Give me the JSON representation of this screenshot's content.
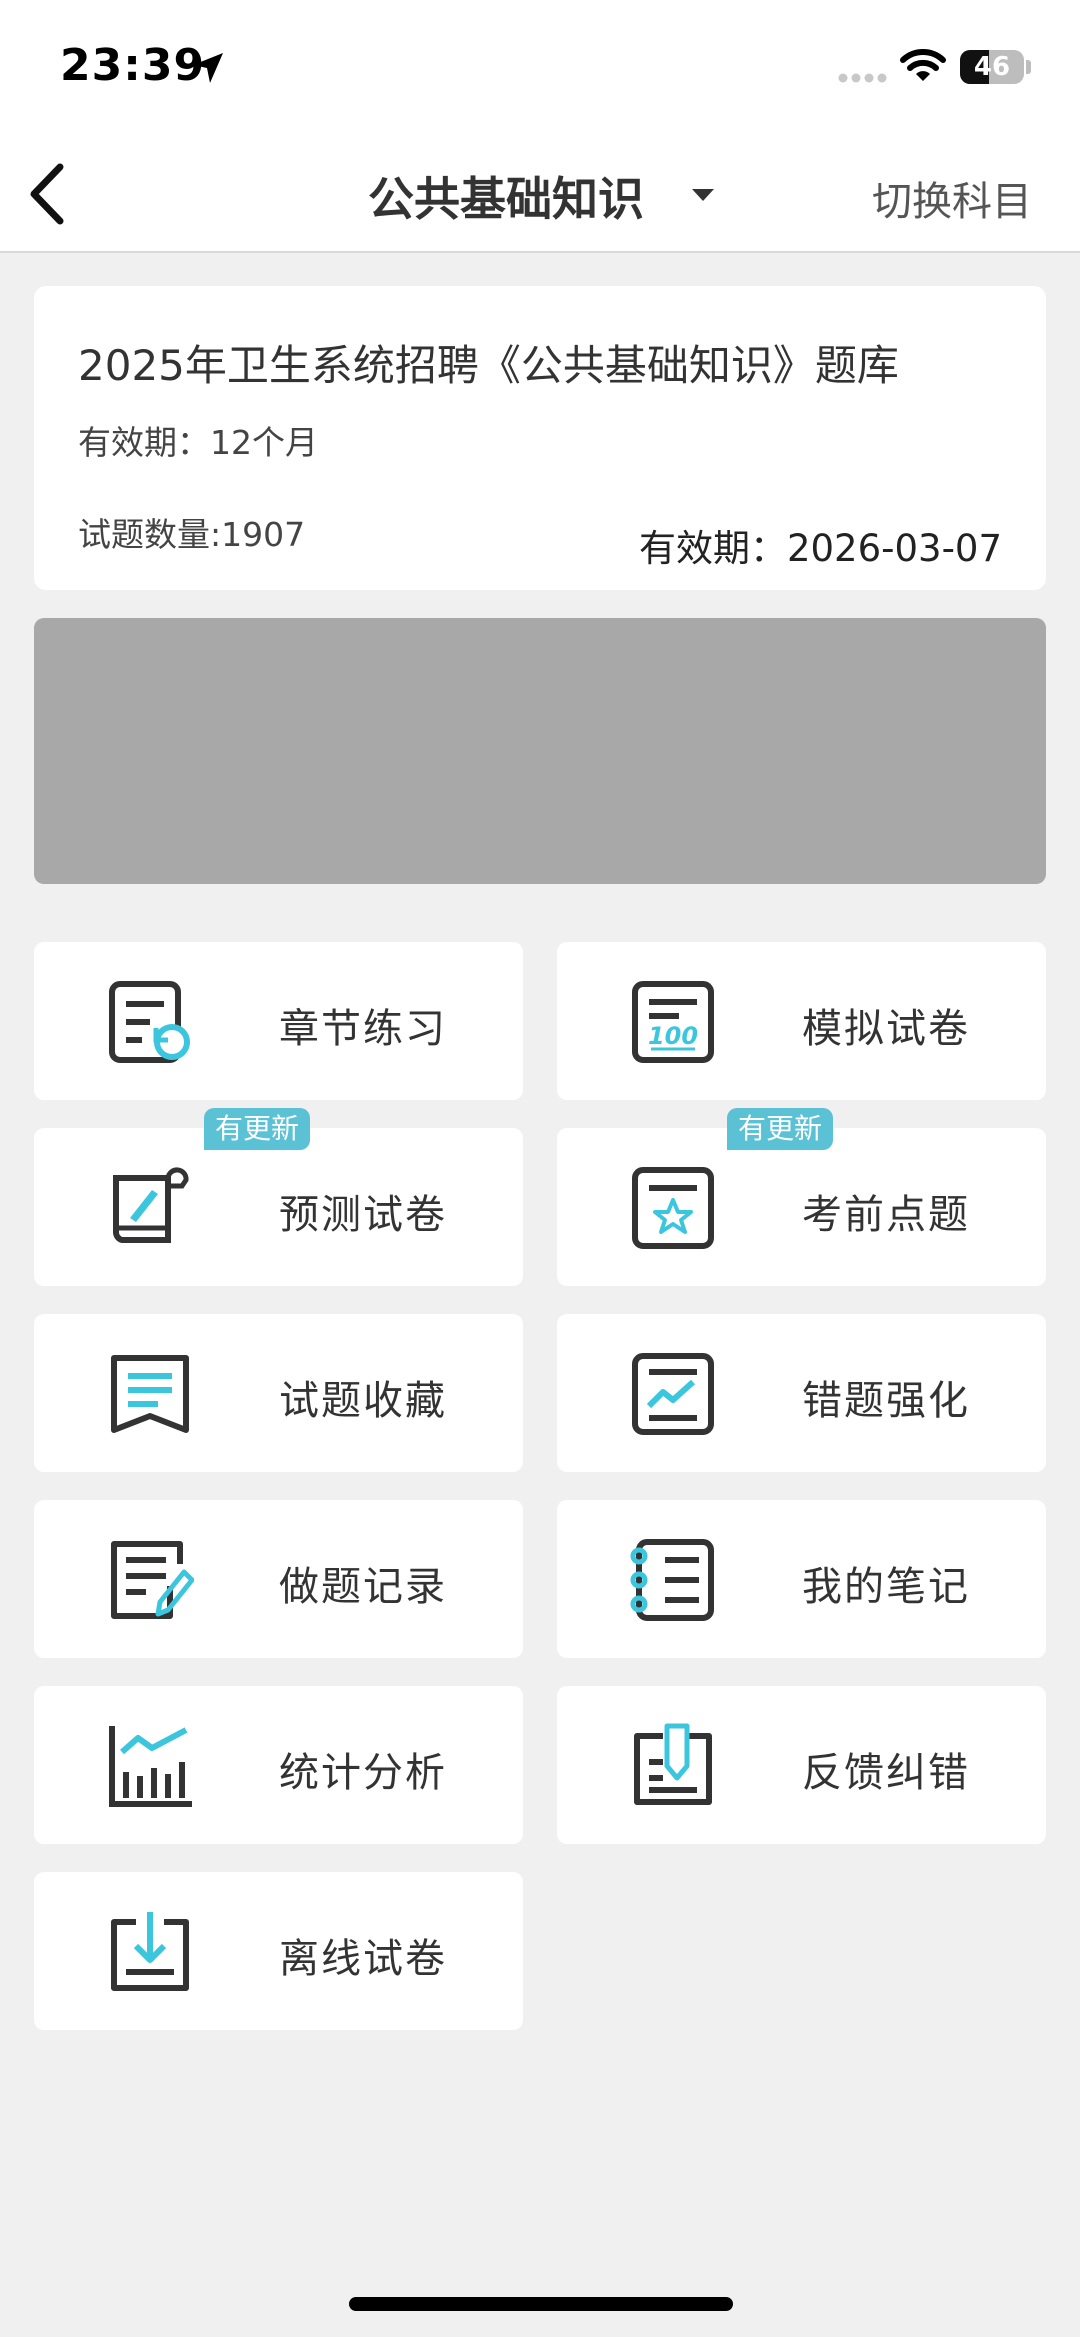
{
  "status": {
    "time": "23:39",
    "battery": "46",
    "battery_level": 0.46
  },
  "nav": {
    "title": "公共基础知识",
    "switch_label": "切换科目"
  },
  "info": {
    "title": "2025年卫生系统招聘《公共基础知识》题库",
    "validity": "有效期：12个月",
    "count": "试题数量:1907",
    "expire": "有效期：2026-03-07"
  },
  "menu": [
    {
      "label": "章节练习",
      "icon": "chapter-practice-icon",
      "badge": ""
    },
    {
      "label": "模拟试卷",
      "icon": "mock-exam-icon",
      "badge": ""
    },
    {
      "label": "预测试卷",
      "icon": "forecast-exam-icon",
      "badge": "有更新"
    },
    {
      "label": "考前点题",
      "icon": "pre-exam-tips-icon",
      "badge": "有更新"
    },
    {
      "label": "试题收藏",
      "icon": "bookmark-questions-icon",
      "badge": ""
    },
    {
      "label": "错题强化",
      "icon": "mistake-review-icon",
      "badge": ""
    },
    {
      "label": "做题记录",
      "icon": "practice-record-icon",
      "badge": ""
    },
    {
      "label": "我的笔记",
      "icon": "notes-icon",
      "badge": ""
    },
    {
      "label": "统计分析",
      "icon": "statistics-icon",
      "badge": ""
    },
    {
      "label": "反馈纠错",
      "icon": "feedback-icon",
      "badge": ""
    },
    {
      "label": "离线试卷",
      "icon": "offline-download-icon",
      "badge": ""
    }
  ],
  "colors": {
    "accent": "#3cc6de",
    "icon_dark": "#333333",
    "badge": "#5bc2d6",
    "background": "#f0f0f0",
    "banner": "#a8a8a8"
  }
}
